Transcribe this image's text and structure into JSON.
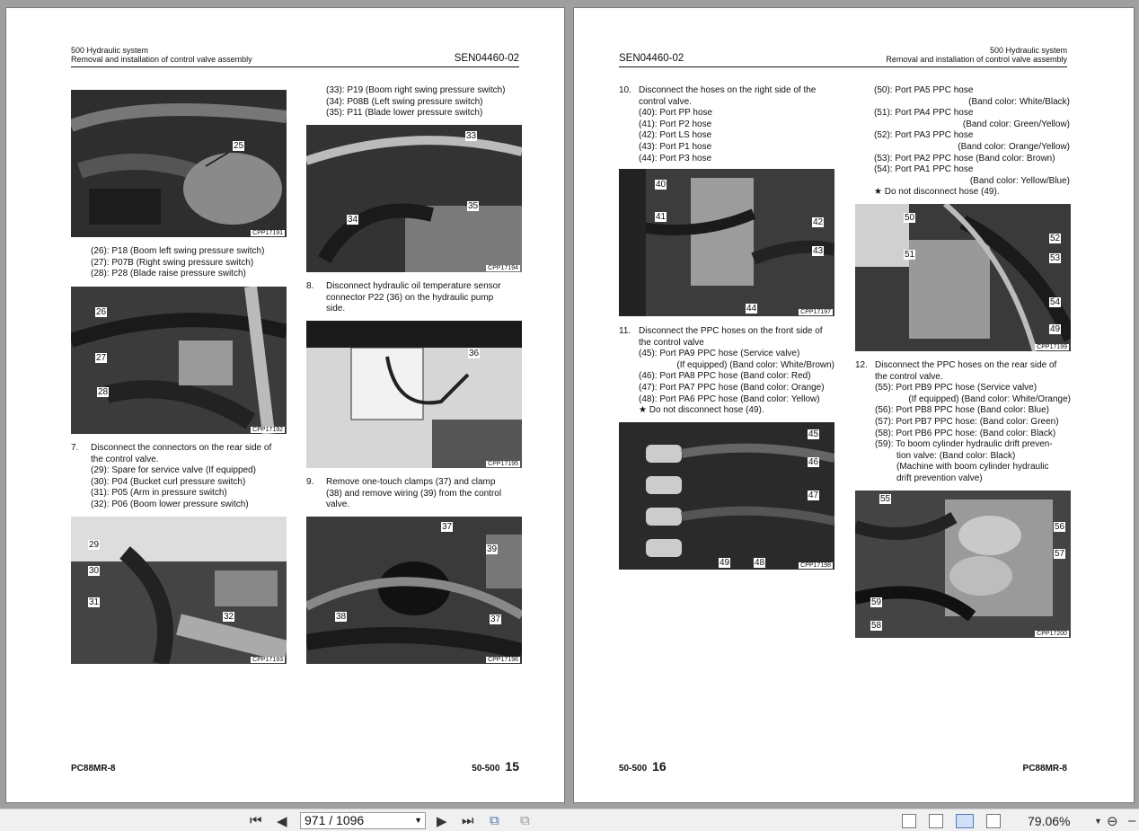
{
  "left_page": {
    "header": {
      "section": "500 Hydraulic system",
      "subtitle": "Removal and installation of control valve assembly",
      "code": "SEN04460-02"
    },
    "col1_text1": [
      "(26): P18 (Boom left swing pressure switch)",
      "(27): P07B (Right swing pressure switch)",
      "(28): P28 (Blade raise pressure switch)"
    ],
    "step7": {
      "num": "7.",
      "lines": [
        "Disconnect the connectors on the rear side of",
        "the control valve."
      ],
      "items": [
        "(29): Spare for service valve (If equipped)",
        "(30): P04 (Bucket curl pressure switch)",
        "(31): P05 (Arm in pressure switch)",
        "(32): P06 (Boom lower pressure switch)"
      ]
    },
    "col2_text1": [
      "(33): P19 (Boom right swing pressure switch)",
      "(34): P08B (Left swing pressure switch)",
      "(35): P11 (Blade lower pressure switch)"
    ],
    "step8": {
      "num": "8.",
      "lines": [
        "Disconnect hydraulic oil temperature sensor",
        "connector P22 (36) on the hydraulic pump",
        "side."
      ]
    },
    "step9": {
      "num": "9.",
      "lines": [
        "Remove one-touch clamps (37) and clamp",
        "(38) and remove wiring (39) from the control",
        "valve."
      ]
    },
    "photos": {
      "p1": {
        "caption": "CPP17191",
        "labels": [
          "25"
        ]
      },
      "p2": {
        "caption": "CPP17192",
        "labels": [
          "26",
          "27",
          "28"
        ]
      },
      "p3": {
        "caption": "CPP17193",
        "labels": [
          "29",
          "30",
          "31",
          "32"
        ]
      },
      "p4": {
        "caption": "CPP17194",
        "labels": [
          "33",
          "34",
          "35"
        ]
      },
      "p5": {
        "caption": "CPP17195",
        "labels": [
          "36"
        ]
      },
      "p6": {
        "caption": "CPP17196",
        "labels": [
          "37",
          "39",
          "38",
          "37"
        ]
      }
    },
    "footer": {
      "model": "PC88MR-8",
      "code": "50-500",
      "page": "15"
    }
  },
  "right_page": {
    "header": {
      "section": "500 Hydraulic system",
      "subtitle": "Removal and installation of control valve assembly",
      "code": "SEN04460-02"
    },
    "step10": {
      "num": "10.",
      "lines": [
        "Disconnect the hoses on the right side of the",
        "control valve."
      ],
      "items": [
        "(40): Port PP hose",
        "(41): Port P2 hose",
        "(42): Port LS hose",
        "(43): Port P1 hose",
        "(44): Port P3 hose"
      ]
    },
    "step11": {
      "num": "11.",
      "lines": [
        "Disconnect the PPC hoses on the front side of",
        "the control valve"
      ],
      "items": [
        "(45): Port PA9 PPC hose (Service valve)",
        "(If equipped) (Band color: White/Brown)",
        "(46): Port PA8 PPC hose (Band color: Red)",
        "(47): Port PA7 PPC hose (Band color: Orange)",
        "(48): Port PA6 PPC hose (Band color: Yellow)",
        "★   Do not disconnect hose (49)."
      ]
    },
    "col2_items": [
      "(50): Port PA5 PPC hose",
      "(Band color: White/Black)",
      "(51): Port PA4 PPC hose",
      "(Band color: Green/Yellow)",
      "(52): Port PA3 PPC hose",
      "(Band color: Orange/Yellow)",
      "(53): Port PA2 PPC hose (Band color: Brown)",
      "(54): Port PA1 PPC hose",
      "(Band color: Yellow/Blue)",
      "★   Do not disconnect hose (49)."
    ],
    "step12": {
      "num": "12.",
      "lines": [
        "Disconnect the PPC hoses on the rear side of",
        "the control valve."
      ],
      "items": [
        "(55): Port PB9 PPC hose (Service valve)",
        "(If equipped) (Band color: White/Orange)",
        "(56): Port PB8 PPC hose (Band color: Blue)",
        "(57): Port PB7 PPC hose: (Band color: Green)",
        "(58): Port PB6 PPC hose: (Band color: Black)",
        "(59): To boom cylinder hydraulic drift preven-",
        "tion valve: (Band color: Black)",
        "(Machine with boom cylinder hydraulic",
        "drift prevention valve)"
      ]
    },
    "photos": {
      "p1": {
        "caption": "CPP17197",
        "labels": [
          "40",
          "41",
          "42",
          "43",
          "44"
        ]
      },
      "p2": {
        "caption": "CPP17198",
        "labels": [
          "45",
          "46",
          "47",
          "49",
          "48"
        ]
      },
      "p3": {
        "caption": "CPP17199",
        "labels": [
          "50",
          "51",
          "52",
          "53",
          "54",
          "49"
        ]
      },
      "p4": {
        "caption": "CPP17200",
        "labels": [
          "55",
          "56",
          "57",
          "59",
          "58"
        ]
      }
    },
    "footer": {
      "model": "PC88MR-8",
      "code": "50-500",
      "page": "16"
    }
  },
  "toolbar": {
    "page_indicator": "971 / 1096",
    "zoom": "79.06%"
  }
}
